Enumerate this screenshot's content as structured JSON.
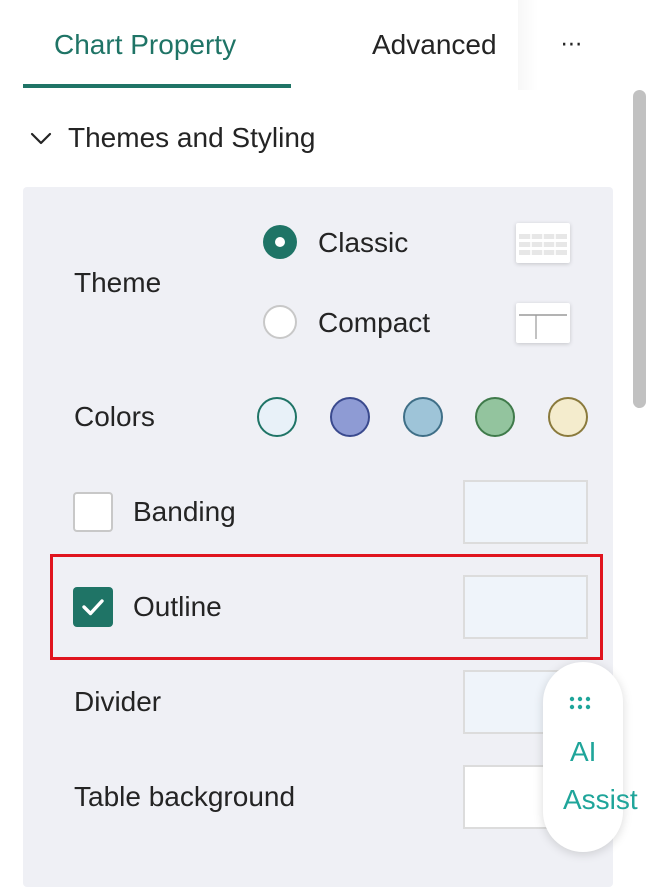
{
  "tabs": {
    "active_label": "Chart Property",
    "inactive_label": "Advanced",
    "more_label": "⋯"
  },
  "section": {
    "title": "Themes and Styling",
    "expanded": true
  },
  "theme": {
    "label": "Theme",
    "options": [
      {
        "label": "Classic",
        "selected": true
      },
      {
        "label": "Compact",
        "selected": false
      }
    ]
  },
  "colors": {
    "label": "Colors",
    "swatches": [
      "#e8f1f8",
      "#8e9bd4",
      "#9ec4d8",
      "#93c49e",
      "#f4eccd"
    ]
  },
  "options": {
    "banding": {
      "label": "Banding",
      "checked": false
    },
    "outline": {
      "label": "Outline",
      "checked": true
    },
    "divider": {
      "label": "Divider"
    },
    "table_background": {
      "label": "Table background"
    }
  },
  "ai_assist": {
    "line1": "AI",
    "line2": "Assist"
  },
  "accent_color": "#1f7466",
  "highlight_color": "#e0141e"
}
